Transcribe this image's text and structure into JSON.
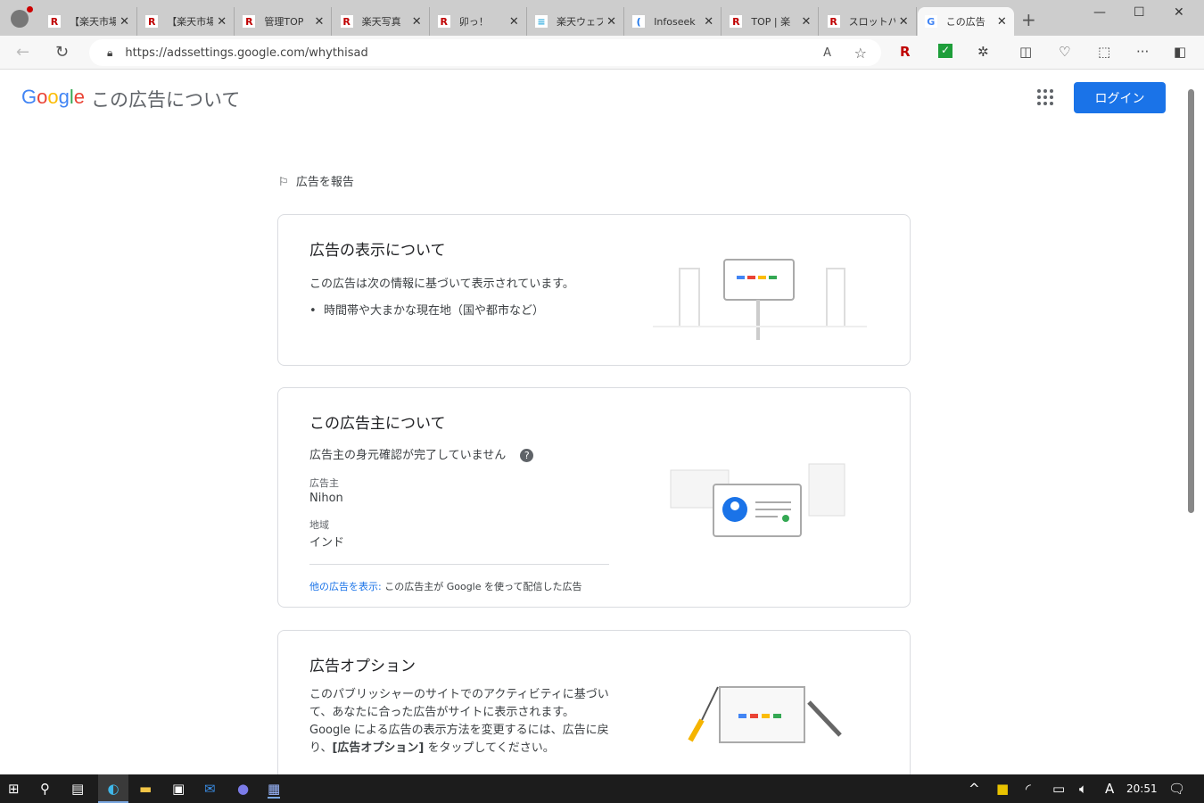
{
  "browser": {
    "tabs": [
      {
        "title": "【楽天市場】",
        "icon": "rakuten-icon"
      },
      {
        "title": "【楽天市場】",
        "icon": "rakuten-icon"
      },
      {
        "title": "管理TOP",
        "icon": "rakuten-icon"
      },
      {
        "title": "楽天写真",
        "icon": "rakuten-icon"
      },
      {
        "title": "卯っ！",
        "icon": "rakuten-icon"
      },
      {
        "title": "楽天ウェブ",
        "icon": "rakuten-web-icon"
      },
      {
        "title": "Infoseek",
        "icon": "infoseek-icon"
      },
      {
        "title": "TOP | 楽",
        "icon": "rakuten-icon"
      },
      {
        "title": "スロットパ",
        "icon": "rakuten-icon"
      },
      {
        "title": "この広告",
        "icon": "google-icon",
        "active": true
      }
    ],
    "url": "https://adssettings.google.com/whythisad"
  },
  "header": {
    "logo": "Google",
    "title": "この広告について",
    "login": "ログイン"
  },
  "report": "広告を報告",
  "card1": {
    "title": "広告の表示について",
    "desc": "この広告は次の情報に基づいて表示されています。",
    "bullets": [
      "時間帯や大まかな現在地（国や都市など）"
    ]
  },
  "card2": {
    "title": "この広告主について",
    "status": "広告主の身元確認が完了していません",
    "advertiser_label": "広告主",
    "advertiser": "Nihon",
    "region_label": "地域",
    "region": "インド",
    "more_link": "他の広告を表示:",
    "more_text": " この広告主が Google を使って配信した広告"
  },
  "card3": {
    "title": "広告オプション",
    "desc1": "このパブリッシャーのサイトでのアクティビティに基づいて、あなたに合った広告がサイトに表示されます。Google による広告の表示方法を変更するには、広告に戻り、",
    "desc_bold": "[広告オプション]",
    "desc2": " をタップしてください。"
  },
  "taskbar": {
    "time": "20:51",
    "ime": "A"
  }
}
